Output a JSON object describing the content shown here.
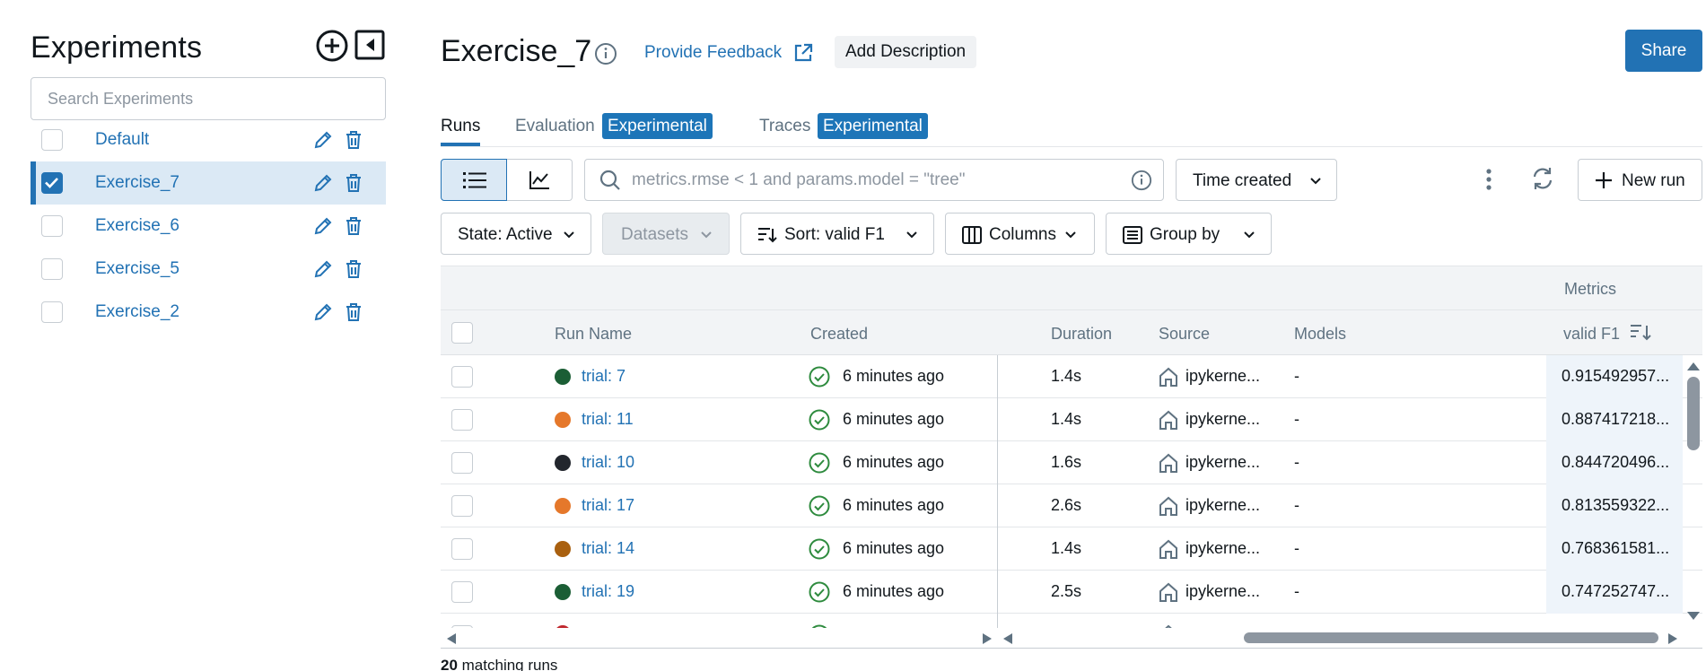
{
  "sidebar": {
    "title": "Experiments",
    "search_placeholder": "Search Experiments",
    "experiments": [
      {
        "name": "Default",
        "selected": false
      },
      {
        "name": "Exercise_7",
        "selected": true
      },
      {
        "name": "Exercise_6",
        "selected": false
      },
      {
        "name": "Exercise_5",
        "selected": false
      },
      {
        "name": "Exercise_2",
        "selected": false
      }
    ]
  },
  "header": {
    "title": "Exercise_7",
    "feedback_label": "Provide Feedback",
    "add_description_label": "Add Description",
    "share_label": "Share"
  },
  "tabs": [
    {
      "label": "Runs",
      "active": true,
      "tag": ""
    },
    {
      "label": "Evaluation",
      "active": false,
      "tag": "Experimental"
    },
    {
      "label": "Traces",
      "active": false,
      "tag": "Experimental"
    }
  ],
  "toolbar": {
    "filter_placeholder": "metrics.rmse < 1 and params.model = \"tree\"",
    "time_created_label": "Time created",
    "new_run_label": "New run",
    "state_label": "State: Active",
    "datasets_label": "Datasets",
    "sort_label": "Sort: valid F1",
    "columns_label": "Columns",
    "group_by_label": "Group by"
  },
  "table": {
    "group_header": "Metrics",
    "columns": {
      "run_name": "Run Name",
      "created": "Created",
      "duration": "Duration",
      "source": "Source",
      "models": "Models",
      "metric": "valid F1"
    },
    "rows": [
      {
        "name": "trial: 7",
        "color": "#1b5e35",
        "created": "6 minutes ago",
        "duration": "1.4s",
        "source": "ipykerne...",
        "models": "-",
        "metric": "0.915492957..."
      },
      {
        "name": "trial: 11",
        "color": "#e5782b",
        "created": "6 minutes ago",
        "duration": "1.4s",
        "source": "ipykerne...",
        "models": "-",
        "metric": "0.887417218..."
      },
      {
        "name": "trial: 10",
        "color": "#22262d",
        "created": "6 minutes ago",
        "duration": "1.6s",
        "source": "ipykerne...",
        "models": "-",
        "metric": "0.844720496..."
      },
      {
        "name": "trial: 17",
        "color": "#e5782b",
        "created": "6 minutes ago",
        "duration": "2.6s",
        "source": "ipykerne...",
        "models": "-",
        "metric": "0.813559322..."
      },
      {
        "name": "trial: 14",
        "color": "#a9600f",
        "created": "6 minutes ago",
        "duration": "1.4s",
        "source": "ipykerne...",
        "models": "-",
        "metric": "0.768361581..."
      },
      {
        "name": "trial: 19",
        "color": "#1b5e35",
        "created": "6 minutes ago",
        "duration": "2.5s",
        "source": "ipykerne...",
        "models": "-",
        "metric": "0.747252747..."
      }
    ]
  },
  "footer": {
    "match_count": "20",
    "match_suffix": " matching runs"
  },
  "colors": {
    "accent": "#2272b4",
    "selected_bg": "#dbe9f5",
    "success": "#2e8b3e",
    "tag_bg": "#1d75b8"
  },
  "icons": [
    "add-circle-icon",
    "collapse-sidebar-icon",
    "edit-icon",
    "trash-icon",
    "info-icon",
    "external-link-icon",
    "list-view-icon",
    "chart-view-icon",
    "search-icon",
    "chevron-down-icon",
    "sort-icon",
    "columns-icon",
    "group-icon",
    "kebab-icon",
    "refresh-icon",
    "plus-icon",
    "check-circle-icon",
    "notebook-icon",
    "sort-desc-icon"
  ]
}
